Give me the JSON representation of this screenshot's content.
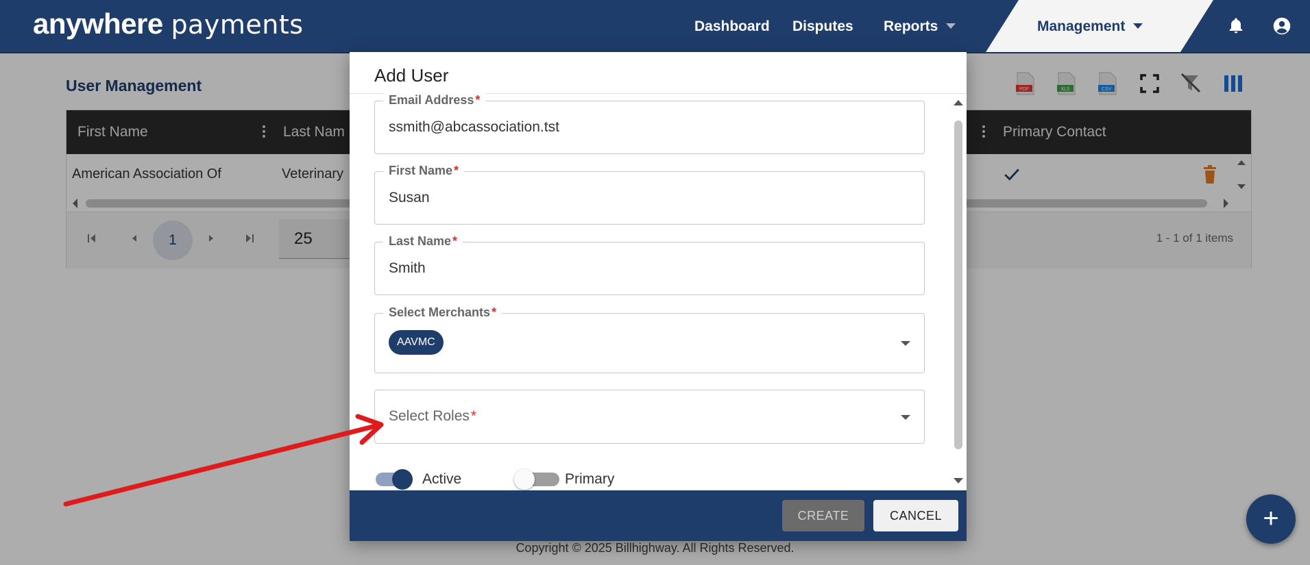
{
  "header": {
    "logo_bold": "anywhere",
    "logo_light": "payments",
    "nav": {
      "dashboard": "Dashboard",
      "disputes": "Disputes",
      "reports": "Reports",
      "management": "Management"
    },
    "icons": [
      "bell-icon",
      "user-account-icon"
    ]
  },
  "page": {
    "title": "User Management",
    "toolbar_icons": [
      "pdf-export-icon",
      "xls-export-icon",
      "csv-export-icon",
      "fullscreen-icon",
      "clear-filter-icon",
      "columns-icon"
    ],
    "table": {
      "columns": [
        "First Name",
        "Last Nam",
        "Primary Contact"
      ],
      "rows": [
        {
          "first_name": "American Association Of",
          "last_name": "Veterinary",
          "primary_contact": true
        }
      ]
    },
    "pager": {
      "current_page": "1",
      "page_size": "25",
      "info": "1 - 1 of 1 items"
    },
    "footer": "Copyright © 2025 Billhighway. All Rights Reserved."
  },
  "dialog": {
    "title": "Add User",
    "fields": {
      "email": {
        "label": "Email Address",
        "value": "ssmith@abcassociation.tst"
      },
      "first_name": {
        "label": "First Name",
        "value": "Susan"
      },
      "last_name": {
        "label": "Last Name",
        "value": "Smith"
      },
      "merchants": {
        "label": "Select Merchants",
        "chips": [
          "AAVMC"
        ]
      },
      "roles": {
        "placeholder": "Select Roles"
      }
    },
    "required_mark": "*",
    "toggles": {
      "active": {
        "label": "Active",
        "on": true
      },
      "primary": {
        "label": "Primary",
        "on": false
      }
    },
    "buttons": {
      "create": "CREATE",
      "cancel": "CANCEL"
    }
  },
  "colors": {
    "brand_navy": "#1f3d6b",
    "required_red": "#d32f2f",
    "annotation_arrow": "#e01b1b"
  }
}
